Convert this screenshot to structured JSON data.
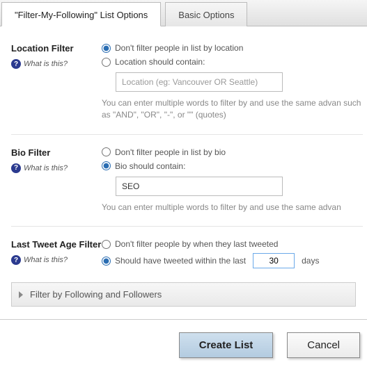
{
  "tabs": {
    "active": "\"Filter-My-Following\" List Options",
    "inactive": "Basic Options"
  },
  "help_text": "What is this?",
  "location": {
    "title": "Location Filter",
    "opt_no": "Don't filter people in list by location",
    "opt_yes": "Location should contain:",
    "placeholder": "Location (eg: Vancouver OR Seattle)",
    "value": "",
    "hint": "You can enter multiple words to filter by and use the same advan such as \"AND\", \"OR\", \"-\", or \"\" (quotes)"
  },
  "bio": {
    "title": "Bio Filter",
    "opt_no": "Don't filter people in list by bio",
    "opt_yes": "Bio should contain:",
    "value": "SEO",
    "hint": "You can enter multiple words to filter by and use the same advan"
  },
  "age": {
    "title": "Last Tweet Age Filter",
    "opt_no": "Don't filter people by when they last tweeted",
    "opt_yes_pre": "Should have tweeted within the last",
    "value": "30",
    "opt_yes_post": "days"
  },
  "accordion": "Filter by Following and Followers",
  "buttons": {
    "create": "Create List",
    "cancel": "Cancel"
  }
}
